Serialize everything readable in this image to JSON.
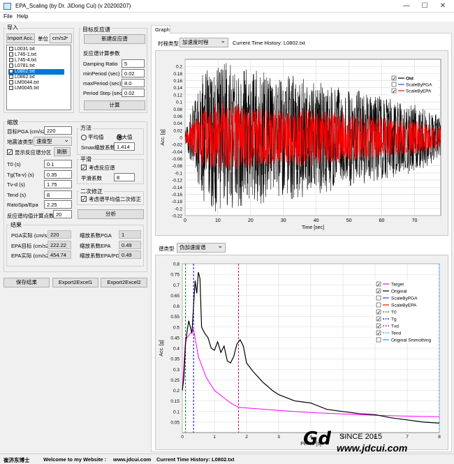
{
  "window": {
    "title": "EPA_Scaling (by Dr. JiDong Cui) (v 20200207)",
    "minimize": "—",
    "maximize": "☐",
    "close": "✕"
  },
  "menu": {
    "file": "File",
    "help": "Help"
  },
  "import": {
    "group": "导入",
    "button": "Import Acc.",
    "unit_label": "单位",
    "unit_value": "cm/s2",
    "files": [
      {
        "name": "L0031.txt",
        "checked": false,
        "selected": false
      },
      {
        "name": "L745-1.txt",
        "checked": false,
        "selected": false
      },
      {
        "name": "L745-4.txt",
        "checked": false,
        "selected": false
      },
      {
        "name": "L0781.txt",
        "checked": false,
        "selected": false
      },
      {
        "name": "L0802.txt",
        "checked": false,
        "selected": true
      },
      {
        "name": "L0862.txt",
        "checked": false,
        "selected": false
      },
      {
        "name": "LM0044.txt",
        "checked": false,
        "selected": false
      },
      {
        "name": "LM0045.txt",
        "checked": false,
        "selected": false
      }
    ]
  },
  "target": {
    "group": "目标反应谱",
    "new_button": "新建反应谱",
    "params_title": "反应谱计算参数",
    "params": [
      {
        "label": "Damping Ratio",
        "value": "5"
      },
      {
        "label": "minPeriod (sec)",
        "value": "0.02"
      },
      {
        "label": "maxPeriod (sec)",
        "value": "8.0"
      },
      {
        "label": "Period Step (sec)",
        "value": "0.02"
      }
    ],
    "calc_button": "计算"
  },
  "scaling": {
    "group": "缩放",
    "target_pga_label": "目标PGA (cm/s2)",
    "target_pga": "220",
    "site_label": "地震波类型",
    "site_value": "速度型",
    "show_label": "显示反应谱分区",
    "refresh_button": "刷新",
    "fields": [
      {
        "label": "T0 (s)",
        "value": "0.1"
      },
      {
        "label": "Tg(Ta-v) (s)",
        "value": "0.35"
      },
      {
        "label": "Tv-d (s)",
        "value": "1.75"
      },
      {
        "label": "Tend (s)",
        "value": "8"
      },
      {
        "label": "RatoSpa/Epa",
        "value": "2.25"
      }
    ],
    "npts_label": "反应谱均值计算点数",
    "npts": "20",
    "method_group": "方法",
    "avg_label": "平均值",
    "max_label": "最大值",
    "smax_label": "Smax缩放系数",
    "smax": "1.414",
    "smooth_group": "平滑",
    "smooth_check": "考虑反应谱",
    "smooth_coef_label": "平滑系数",
    "smooth_coef": "8",
    "second_group": "二次修正",
    "second_check": "考虑谱平均值二次修正",
    "analyze_button": "分析"
  },
  "results": {
    "group": "结果",
    "left": [
      {
        "label": "PGA实际 (cm/s2)",
        "value": "220"
      },
      {
        "label": "EPA目标 (cm/s2)",
        "value": "222.22"
      },
      {
        "label": "EPA实际 (cm/s2)",
        "value": "454.74"
      }
    ],
    "right": [
      {
        "label": "缩放系数PGA",
        "value": "1"
      },
      {
        "label": "缩放系数EPA",
        "value": "0.49"
      },
      {
        "label": "缩放系数EPA/PGA",
        "value": "0.49"
      }
    ]
  },
  "bottom_buttons": {
    "save": "保存结果",
    "export1": "Export2Excel1",
    "export2": "Export2Excel2"
  },
  "graph": {
    "tab": "Graph",
    "time_type_label": "时程类型",
    "time_type": "加速度时程",
    "current_label": "Current Time History: L0802.txt",
    "spectrum_type_label": "谱类型",
    "spectrum_type": "伪加速度谱"
  },
  "chart_data": [
    {
      "type": "line",
      "title": "",
      "xlabel": "Time [sec]",
      "ylabel": "Acc. [g]",
      "xlim": [
        0,
        78
      ],
      "ylim": [
        -0.22,
        0.22
      ],
      "xticks": [
        "0",
        "10",
        "20",
        "30",
        "40",
        "50",
        "60",
        "70"
      ],
      "yticks": [
        "0.2",
        "0.18",
        "0.16",
        "0.14",
        "0.12",
        "0.1",
        "0.08",
        "0.06",
        "0.04",
        "0.02",
        "0",
        "-0.02",
        "-0.04",
        "-0.06",
        "-0.08",
        "-0.1",
        "-0.12",
        "-0.14",
        "-0.16",
        "-0.18",
        "-0.2",
        "-0.22"
      ],
      "grid": true,
      "legend_position": "top-right",
      "series": [
        {
          "name": "Old",
          "checked": true,
          "color": "#000000"
        },
        {
          "name": "ScaleByPGA",
          "checked": false,
          "color": "#1f4fd6"
        },
        {
          "name": "ScaleByEPA",
          "checked": true,
          "color": "#ff0000"
        }
      ],
      "envelope": {
        "Old": [
          [
            0,
            0.02
          ],
          [
            2,
            0.08
          ],
          [
            5,
            0.18
          ],
          [
            8,
            0.2
          ],
          [
            11,
            0.22
          ],
          [
            15,
            0.2
          ],
          [
            20,
            0.2
          ],
          [
            25,
            0.18
          ],
          [
            30,
            0.18
          ],
          [
            40,
            0.16
          ],
          [
            50,
            0.14
          ],
          [
            60,
            0.12
          ],
          [
            70,
            0.1
          ],
          [
            78,
            0.06
          ]
        ],
        "ScaleByEPA": [
          [
            0,
            0.01
          ],
          [
            2,
            0.04
          ],
          [
            5,
            0.08
          ],
          [
            10,
            0.1
          ],
          [
            20,
            0.09
          ],
          [
            30,
            0.08
          ],
          [
            40,
            0.08
          ],
          [
            50,
            0.07
          ],
          [
            60,
            0.06
          ],
          [
            70,
            0.05
          ],
          [
            78,
            0.03
          ]
        ]
      }
    },
    {
      "type": "line",
      "title": "",
      "xlabel": "Period [s]",
      "ylabel": "Acc. [g]",
      "xlim": [
        0,
        8
      ],
      "ylim": [
        0,
        0.8
      ],
      "xticks": [
        "0",
        "1",
        "2",
        "3",
        "4",
        "5",
        "6",
        "7",
        "8"
      ],
      "yticks": [
        "0.8",
        "0.75",
        "0.7",
        "0.65",
        "0.6",
        "0.55",
        "0.5",
        "0.45",
        "0.4",
        "0.35",
        "0.3",
        "0.25",
        "0.2",
        "0.15",
        "0.1",
        "0.05"
      ],
      "grid": true,
      "legend_position": "right",
      "series": [
        {
          "name": "Target",
          "checked": true,
          "color": "#ff00ff",
          "points": [
            [
              0,
              0.2
            ],
            [
              0.1,
              0.44
            ],
            [
              0.35,
              0.49
            ],
            [
              0.5,
              0.36
            ],
            [
              0.75,
              0.26
            ],
            [
              1,
              0.2
            ],
            [
              1.5,
              0.14
            ],
            [
              1.75,
              0.12
            ],
            [
              3,
              0.105
            ],
            [
              4,
              0.095
            ],
            [
              5,
              0.088
            ],
            [
              6,
              0.082
            ],
            [
              7,
              0.078
            ],
            [
              8,
              0.075
            ]
          ]
        },
        {
          "name": "Original",
          "checked": true,
          "color": "#000000",
          "points": [
            [
              0,
              0.2
            ],
            [
              0.05,
              0.26
            ],
            [
              0.1,
              0.42
            ],
            [
              0.15,
              0.48
            ],
            [
              0.2,
              0.53
            ],
            [
              0.3,
              0.47
            ],
            [
              0.35,
              0.6
            ],
            [
              0.4,
              0.72
            ],
            [
              0.45,
              0.66
            ],
            [
              0.5,
              0.76
            ],
            [
              0.55,
              0.73
            ],
            [
              0.6,
              0.5
            ],
            [
              0.7,
              0.47
            ],
            [
              0.8,
              0.45
            ],
            [
              0.9,
              0.4
            ],
            [
              1.0,
              0.39
            ],
            [
              1.1,
              0.43
            ],
            [
              1.2,
              0.38
            ],
            [
              1.3,
              0.41
            ],
            [
              1.4,
              0.34
            ],
            [
              1.5,
              0.33
            ],
            [
              1.6,
              0.36
            ],
            [
              1.7,
              0.42
            ],
            [
              1.8,
              0.44
            ],
            [
              1.9,
              0.41
            ],
            [
              2.0,
              0.33
            ],
            [
              2.2,
              0.29
            ],
            [
              2.5,
              0.24
            ],
            [
              2.8,
              0.2
            ],
            [
              3.0,
              0.18
            ],
            [
              3.5,
              0.15
            ],
            [
              4.0,
              0.14
            ],
            [
              4.5,
              0.11
            ],
            [
              5.0,
              0.1
            ],
            [
              5.5,
              0.09
            ],
            [
              6.0,
              0.085
            ],
            [
              6.5,
              0.07
            ],
            [
              7.0,
              0.06
            ],
            [
              7.5,
              0.05
            ],
            [
              8,
              0.045
            ]
          ]
        },
        {
          "name": "ScaleByPGA",
          "checked": false,
          "color": "#1f4fd6"
        },
        {
          "name": "ScaleByEPA",
          "checked": false,
          "color": "#ff0000"
        },
        {
          "name": "T0",
          "checked": true,
          "color": "#008000",
          "x": 0.1
        },
        {
          "name": "Tg",
          "checked": true,
          "color": "#0000cc",
          "x": 0.35
        },
        {
          "name": "Tvd",
          "checked": true,
          "color": "#cc0066",
          "x": 1.75
        },
        {
          "name": "Tend",
          "checked": true,
          "color": "#3399ff",
          "x": 8
        },
        {
          "name": "Original Smmothing",
          "checked": false,
          "color": "#00aaff"
        }
      ]
    }
  ],
  "watermark": {
    "text": "SINCE 2015",
    "url": "www.jdcui.com"
  },
  "status": {
    "author": "崔济东博士",
    "welcome": "Welcome to my Website :",
    "site": "www.jdcui.com",
    "current": "Current Time History: L0802.txt"
  }
}
